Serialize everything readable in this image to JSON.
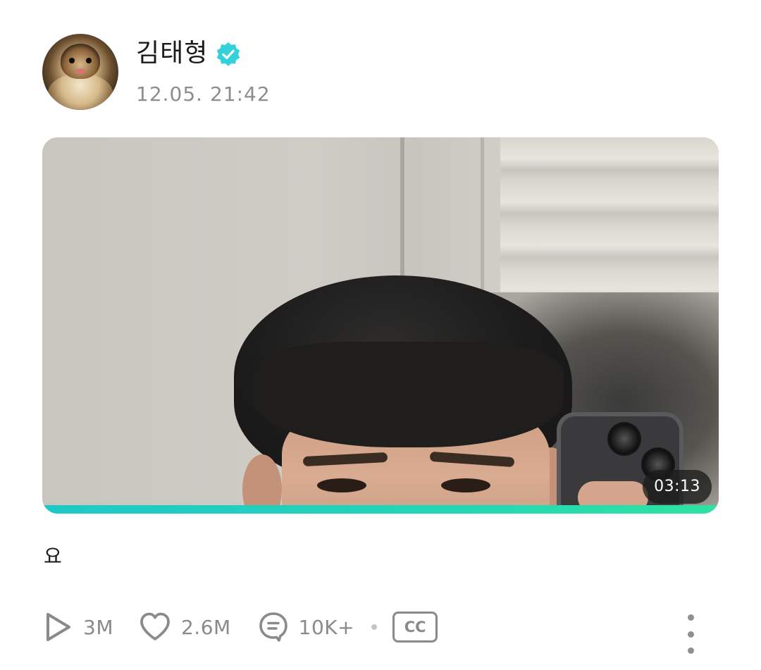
{
  "author": {
    "name": "김태형",
    "verified": true,
    "verified_color": "#33d1dc",
    "avatar_icon": "pomeranian-dog-avatar"
  },
  "post": {
    "timestamp": "12.05. 21:42",
    "text": "요"
  },
  "video": {
    "duration": "03:13",
    "progress_percent": 100,
    "progress_color_start": "#1ec8c6",
    "progress_color_end": "#2de3a0"
  },
  "stats": {
    "plays": "3M",
    "likes": "2.6M",
    "comments": "10K+",
    "cc_label": "CC",
    "play_icon": "play-icon",
    "like_icon": "heart-icon",
    "comment_icon": "comment-icon",
    "more_icon": "more-vertical-icon",
    "icon_color": "#8a8a8a"
  }
}
